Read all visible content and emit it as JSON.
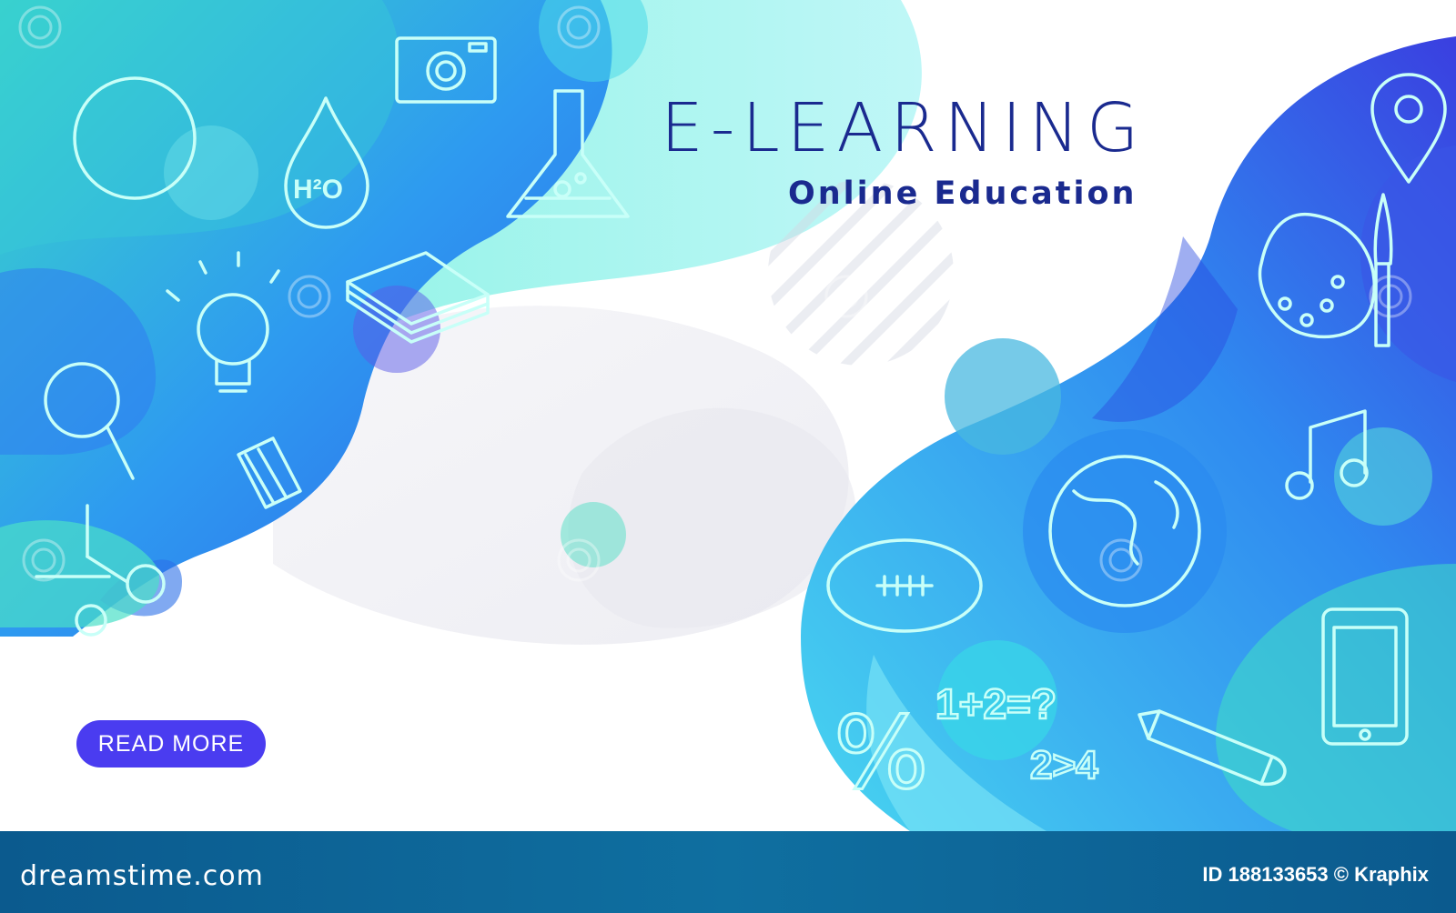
{
  "banner": {
    "title": "E-LEARNING",
    "subtitle": "Online Education",
    "button_label": "READ MORE"
  },
  "footer": {
    "brand": "dreamstime.com",
    "credit": "ID 188133653 © Kraphix"
  },
  "icons": {
    "formula_1": "1+2=?",
    "formula_2": "2>4",
    "water_label": "H²O",
    "percent": "%"
  },
  "colors": {
    "title": "#1a2a8f",
    "button": "#4a3cf0",
    "footer": "#0b5a8e",
    "wave_blue": "#2f7bf0",
    "wave_teal": "#3fe0d0"
  }
}
